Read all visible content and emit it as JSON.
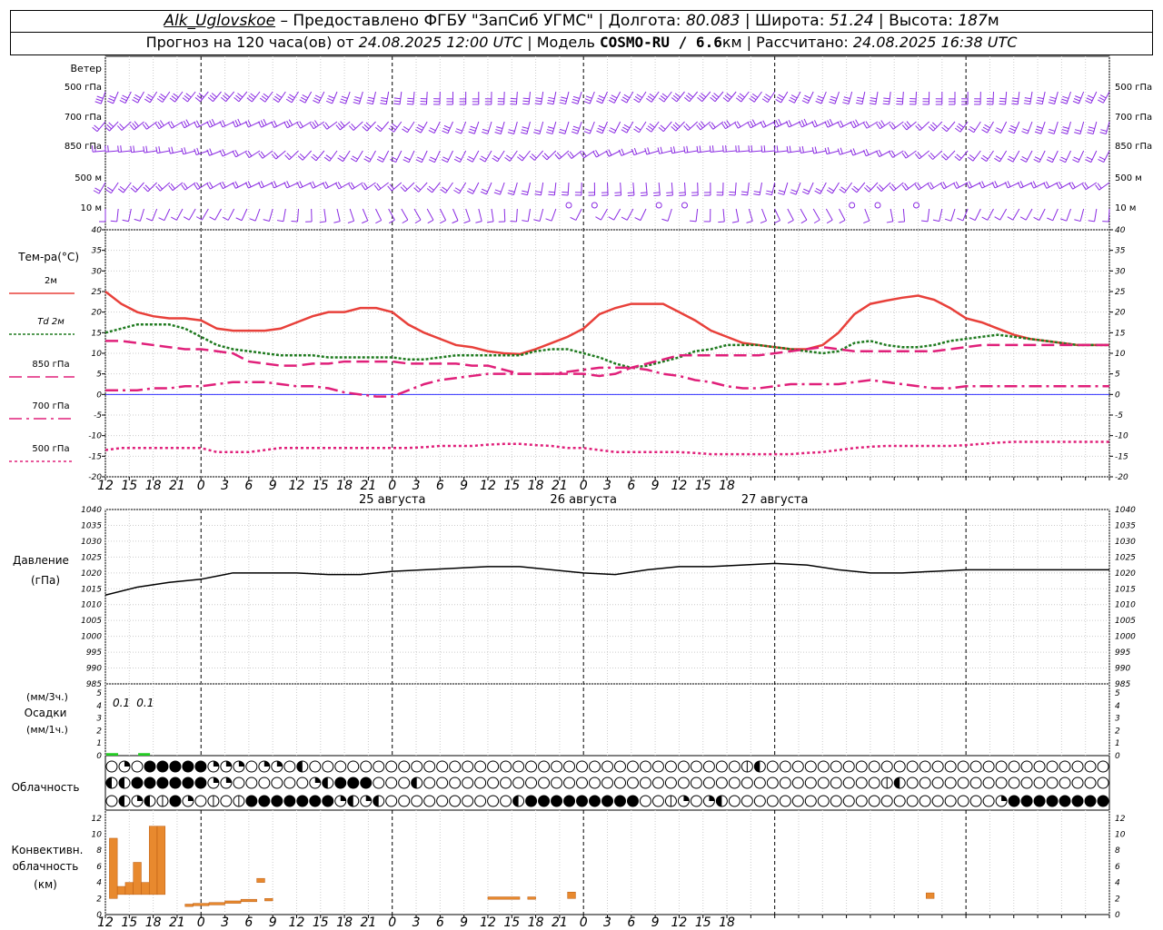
{
  "header": {
    "station": "Alk_Uglovskoe",
    "dash": " – ",
    "provider": "Предоставлено ФГБУ \"ЗапСиб УГМС\"",
    "sep": " | ",
    "lon_label": "Долгота: ",
    "lon": "80.083",
    "lat_label": "Широта: ",
    "lat": "51.24",
    "alt_label": "Высота: ",
    "alt": "187",
    "alt_unit": "м",
    "forecast_label": "Прогноз на 120 часа(ов) от ",
    "forecast_date": "24.08.2025 12:00 UTC",
    "model_label": "Модель ",
    "model": "COSMO-RU / 6.6",
    "model_unit": "км",
    "calc_label": "Рассчитано: ",
    "calc_date": "24.08.2025 16:38 UTC"
  },
  "colors": {
    "t2m": "#e8403a",
    "td": "#1f7a1f",
    "t850": "#e0207a",
    "t700": "#e0207a",
    "t500": "#e0207a",
    "wind": "#8a2be2",
    "pressure": "#000000",
    "precip": "#22cc22",
    "conv": "#e8892e",
    "zero_line": "#3030ff"
  },
  "wind_panel": {
    "title": "Ветер",
    "levels": [
      "500 гПа",
      "700 гПа",
      "850 гПа",
      "500 м",
      "10 м"
    ],
    "levels_right": [
      "500 гПа",
      "700 гПа",
      "850 гПа",
      "500 м",
      "10 м"
    ]
  },
  "temp_panel": {
    "title": "Тем-ра(°C)",
    "legend": [
      {
        "label": "2м",
        "style": "solid",
        "series": "t2m"
      },
      {
        "label": "Td 2м",
        "style": "dotted",
        "series": "td"
      },
      {
        "label": "850 гПа",
        "style": "dashed",
        "series": "t850"
      },
      {
        "label": "700 гПа",
        "style": "dashdot",
        "series": "t700"
      },
      {
        "label": "500 гПа",
        "style": "dotted",
        "series": "t500"
      }
    ]
  },
  "pressure_panel": {
    "title_1": "Давление",
    "title_2": "(гПа)"
  },
  "precip_panel": {
    "title_1": "(мм/3ч.)",
    "title_2": "Осадки",
    "title_3": "(мм/1ч.)",
    "labels": [
      {
        "x": 14,
        "text": "0.1"
      },
      {
        "x": 17,
        "text": "0.1"
      }
    ],
    "left_ticks": [
      "5",
      "4",
      "3",
      "2",
      "1",
      "0"
    ],
    "right_ticks": [
      "5",
      "4",
      "3",
      "2",
      "1",
      "0"
    ]
  },
  "cloud_panel": {
    "title": "Облачность"
  },
  "conv_panel": {
    "title_1": "Конвективн.",
    "title_2": "облачность",
    "title_3": "(км)"
  },
  "x_axis": {
    "start_hour": 12,
    "end_hour": 138,
    "tick_labels": [
      "12",
      "15",
      "18",
      "21",
      "0",
      "3",
      "6",
      "9",
      "12",
      "15",
      "18",
      "21",
      "0",
      "3",
      "6",
      "9",
      "12",
      "15",
      "18",
      "21",
      "0",
      "3",
      "6",
      "9",
      "12",
      "15",
      "18"
    ],
    "day_labels": [
      {
        "x": 48,
        "text": "25 августа"
      },
      {
        "x": 72,
        "text": "26 августа"
      },
      {
        "x": 96,
        "text": "27 августа"
      }
    ]
  },
  "chart_data": [
    {
      "type": "line",
      "name": "temperature",
      "ylabel": "Тем-ра(°C)",
      "ylim": [
        -20,
        40
      ],
      "yticks": [
        40,
        35,
        30,
        25,
        20,
        15,
        10,
        5,
        0,
        -5,
        -10,
        -15,
        -20
      ],
      "x": [
        12,
        14,
        16,
        18,
        20,
        22,
        24,
        26,
        28,
        30,
        32,
        34,
        36,
        38,
        40,
        42,
        44,
        46,
        48,
        50,
        52,
        54,
        56,
        58,
        60,
        62,
        64,
        66,
        68,
        70,
        72,
        74,
        76,
        78,
        80,
        82,
        84,
        86,
        88,
        90,
        92,
        94,
        96,
        98,
        100,
        102,
        104,
        106,
        108,
        110,
        112,
        114,
        116,
        118,
        120,
        122,
        124,
        126,
        128,
        130,
        132,
        134,
        136,
        138
      ],
      "series": [
        {
          "name": "2м",
          "values": [
            25,
            22,
            20,
            19,
            18.5,
            18.5,
            18,
            16,
            15.5,
            15.5,
            15.5,
            16,
            17.5,
            19,
            20,
            20,
            21,
            21,
            20,
            17,
            15,
            13.5,
            12,
            11.5,
            10.5,
            10,
            9.8,
            11,
            12.5,
            14,
            16,
            19.5,
            21,
            22,
            22,
            22,
            20,
            18,
            15.5,
            14,
            12.5,
            12,
            11.5,
            11,
            11,
            12,
            15,
            19.5,
            22,
            22.8,
            23.5,
            24,
            23,
            21,
            18.5,
            17.5,
            16,
            14.5,
            13.5,
            13,
            12.5,
            12,
            12,
            12
          ]
        },
        {
          "name": "Td 2м",
          "values": [
            15,
            16,
            17,
            17,
            17,
            16,
            14,
            12,
            11,
            10.5,
            10,
            9.5,
            9.5,
            9.5,
            9,
            9,
            9,
            9,
            9,
            8.5,
            8.5,
            9,
            9.5,
            9.5,
            9.5,
            9.5,
            9.5,
            10.5,
            11,
            11,
            10,
            9,
            7.5,
            6.5,
            7,
            8,
            9,
            10.5,
            11,
            12,
            12,
            12,
            11.5,
            11,
            10.5,
            10,
            10.5,
            12.5,
            13,
            12,
            11.5,
            11.5,
            12,
            13,
            13.5,
            14,
            14.5,
            14,
            13.5,
            13,
            12.5,
            12,
            12,
            12
          ]
        },
        {
          "name": "850 гПа",
          "values": [
            13,
            13,
            12.5,
            12,
            11.5,
            11,
            11,
            10.5,
            10,
            8,
            7.5,
            7,
            7,
            7.5,
            7.5,
            8,
            8,
            8,
            8,
            7.5,
            7.5,
            7.5,
            7.5,
            7,
            7,
            6,
            5,
            5,
            5,
            5,
            5,
            4.5,
            5,
            6.5,
            7.5,
            8.5,
            9.5,
            9.5,
            9.5,
            9.5,
            9.5,
            9.5,
            10,
            10.5,
            11,
            11.5,
            11,
            10.5,
            10.5,
            10.5,
            10.5,
            10.5,
            10.5,
            11,
            11.5,
            12,
            12,
            12,
            12,
            12,
            12,
            12,
            12,
            12
          ]
        },
        {
          "name": "700 гПа",
          "values": [
            1,
            1,
            1,
            1.5,
            1.5,
            2,
            2,
            2.5,
            3,
            3,
            3,
            2.5,
            2,
            2,
            1.5,
            0.5,
            0,
            -0.5,
            -0.5,
            1,
            2.5,
            3.5,
            4,
            4.5,
            5,
            5,
            5,
            5,
            5,
            5.5,
            6,
            6.5,
            6.5,
            6.5,
            6,
            5,
            4.5,
            3.5,
            3,
            2,
            1.5,
            1.5,
            2,
            2.5,
            2.5,
            2.5,
            2.5,
            3,
            3.5,
            3,
            2.5,
            2,
            1.5,
            1.5,
            2,
            2,
            2,
            2,
            2,
            2,
            2,
            2,
            2,
            2
          ]
        },
        {
          "name": "500 гПа",
          "values": [
            -13.5,
            -13,
            -13,
            -13,
            -13,
            -13,
            -13,
            -14,
            -14,
            -14,
            -13.5,
            -13,
            -13,
            -13,
            -13,
            -13,
            -13,
            -13,
            -13,
            -13,
            -12.8,
            -12.5,
            -12.5,
            -12.5,
            -12.2,
            -12,
            -12,
            -12.3,
            -12.5,
            -13,
            -13,
            -13.5,
            -14,
            -14,
            -14,
            -14,
            -14,
            -14.2,
            -14.5,
            -14.5,
            -14.5,
            -14.5,
            -14.5,
            -14.5,
            -14.2,
            -14,
            -13.5,
            -13,
            -12.7,
            -12.5,
            -12.5,
            -12.5,
            -12.5,
            -12.5,
            -12.3,
            -12,
            -11.7,
            -11.5,
            -11.5,
            -11.5,
            -11.5,
            -11.5,
            -11.5,
            -11.5
          ]
        }
      ]
    },
    {
      "type": "line",
      "name": "pressure",
      "ylabel": "Давление (гПа)",
      "ylim": [
        985,
        1040
      ],
      "yticks": [
        1040,
        1035,
        1030,
        1025,
        1020,
        1015,
        1010,
        1005,
        1000,
        995,
        990,
        985
      ],
      "x": [
        12,
        16,
        20,
        24,
        28,
        32,
        36,
        40,
        44,
        48,
        52,
        56,
        60,
        64,
        68,
        72,
        76,
        80,
        84,
        88,
        92,
        96,
        100,
        104,
        108,
        112,
        116,
        120,
        124,
        128,
        132,
        136,
        138
      ],
      "series": [
        {
          "name": "Давление",
          "values": [
            1013,
            1015.5,
            1017,
            1018,
            1020,
            1020,
            1020,
            1019.5,
            1019.5,
            1020.5,
            1021,
            1021.5,
            1022,
            1022,
            1021,
            1020,
            1019.5,
            1021,
            1022,
            1022,
            1022.5,
            1023,
            1022.5,
            1021,
            1020,
            1020,
            1020.5,
            1021,
            1021,
            1021,
            1021,
            1021,
            1021
          ]
        }
      ]
    },
    {
      "type": "bar",
      "name": "precipitation",
      "ylim": [
        0,
        5
      ],
      "yticks": [
        5,
        4,
        3,
        2,
        1,
        0
      ],
      "x": [
        12,
        16
      ],
      "values": [
        0.2,
        0.2
      ]
    },
    {
      "type": "bar",
      "name": "convective_cloudiness",
      "ylabel": "Конвективн. облачность (км)",
      "ylim": [
        0,
        13
      ],
      "yticks": [
        12,
        10,
        8,
        6,
        4,
        2,
        0
      ],
      "bars": [
        {
          "x0": 12.5,
          "x1": 13.5,
          "bottom": 2,
          "top": 9.5
        },
        {
          "x0": 13.5,
          "x1": 14.5,
          "bottom": 2.5,
          "top": 3.5
        },
        {
          "x0": 14.5,
          "x1": 15.5,
          "bottom": 2.5,
          "top": 4
        },
        {
          "x0": 15.5,
          "x1": 16.5,
          "bottom": 2.5,
          "top": 6.5
        },
        {
          "x0": 16.5,
          "x1": 17.5,
          "bottom": 2.5,
          "top": 4
        },
        {
          "x0": 17.5,
          "x1": 18.5,
          "bottom": 2.5,
          "top": 11
        },
        {
          "x0": 18.5,
          "x1": 19.5,
          "bottom": 2.5,
          "top": 11
        },
        {
          "x0": 22,
          "x1": 23,
          "bottom": 1,
          "top": 1.3
        },
        {
          "x0": 23,
          "x1": 25,
          "bottom": 1.1,
          "top": 1.4
        },
        {
          "x0": 25,
          "x1": 27,
          "bottom": 1.2,
          "top": 1.5
        },
        {
          "x0": 27,
          "x1": 29,
          "bottom": 1.4,
          "top": 1.7
        },
        {
          "x0": 29,
          "x1": 31,
          "bottom": 1.6,
          "top": 1.9
        },
        {
          "x0": 31,
          "x1": 32,
          "bottom": 4,
          "top": 4.5
        },
        {
          "x0": 32,
          "x1": 33,
          "bottom": 1.7,
          "top": 2
        },
        {
          "x0": 60,
          "x1": 64,
          "bottom": 1.9,
          "top": 2.2
        },
        {
          "x0": 65,
          "x1": 66,
          "bottom": 1.9,
          "top": 2.2
        },
        {
          "x0": 70,
          "x1": 71,
          "bottom": 2,
          "top": 2.8
        },
        {
          "x0": 115,
          "x1": 116,
          "bottom": 2,
          "top": 2.7
        }
      ]
    }
  ],
  "clouds": {
    "rows": [
      "0C3HHHHHCCC0CC0D0000000000000000000000000000000000ID00000000000000000000000000000DC0HC0000000000000000000000000000000000000000000000000",
      "DDHHHHHHCC000000CDHHH000D000000000000000000000000000000000000ID000000000000000000000000000000000000000000000000000000000000000000000000",
      "0DCDIHC0I0IHHHHHHHCDCD0000000000DHHHHHHHHH00IC0CD000000000000000000000CHHHHHHHHI0DD000000000000000000000000000000000000000000000000000"
    ]
  }
}
